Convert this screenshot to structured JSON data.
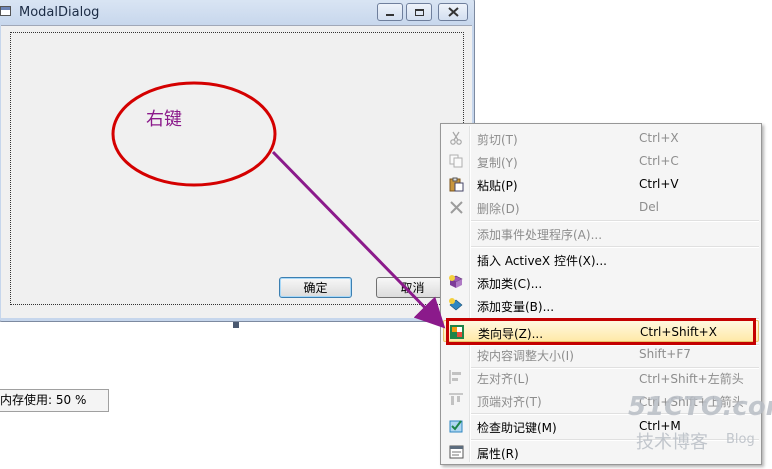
{
  "window": {
    "title": "ModalDialog",
    "ok_label": "确定",
    "cancel_label": "取消"
  },
  "status": {
    "text": "内存使用: 50 %"
  },
  "annotation": {
    "text": "右键",
    "color": "#8b1a8b",
    "ellipse_color": "#d40000",
    "arrow_color": "#8b1a8b"
  },
  "menu": {
    "items": [
      {
        "label": "剪切(T)",
        "shortcut": "Ctrl+X",
        "icon": "scissors-icon"
      },
      {
        "label": "复制(Y)",
        "shortcut": "Ctrl+C",
        "icon": "copy-icon"
      },
      {
        "label": "粘贴(P)",
        "shortcut": "Ctrl+V",
        "icon": "paste-icon"
      },
      {
        "label": "删除(D)",
        "shortcut": "Del",
        "icon": "delete-icon"
      },
      {
        "label": "添加事件处理程序(A)...",
        "shortcut": ""
      },
      {
        "label": "插入 ActiveX 控件(X)...",
        "shortcut": ""
      },
      {
        "label": "添加类(C)...",
        "shortcut": "",
        "icon": "add-class-icon"
      },
      {
        "label": "添加变量(B)...",
        "shortcut": "",
        "icon": "add-variable-icon"
      },
      {
        "label": "类向导(Z)...",
        "shortcut": "Ctrl+Shift+X",
        "icon": "class-wizard-icon"
      },
      {
        "label": "按内容调整大小(I)",
        "shortcut": "Shift+F7"
      },
      {
        "label": "左对齐(L)",
        "shortcut": "Ctrl+Shift+左箭头",
        "icon": "align-left-icon"
      },
      {
        "label": "顶端对齐(T)",
        "shortcut": "Ctrl+Shift+上箭头",
        "icon": "align-top-icon"
      },
      {
        "label": "检查助记键(M)",
        "shortcut": "Ctrl+M",
        "icon": "check-mnemonics-icon"
      },
      {
        "label": "属性(R)",
        "shortcut": "",
        "icon": "properties-icon"
      }
    ]
  },
  "watermark": {
    "line1": "51CTO.com",
    "line2": "技术博客",
    "line3": "Blog"
  }
}
